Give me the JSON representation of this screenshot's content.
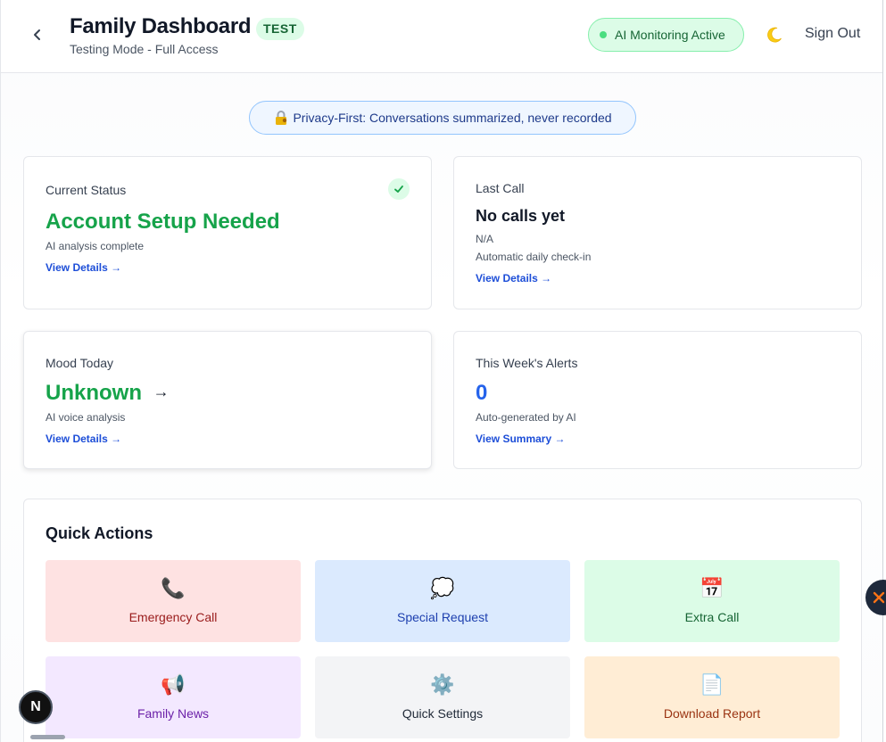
{
  "header": {
    "title": "Family Dashboard",
    "badge": "TEST",
    "subtitle": "Testing Mode - Full Access",
    "ai_status": "AI Monitoring Active",
    "sign_out": "Sign Out",
    "back_icon": "chevron-left-icon",
    "theme_icon": "moon-icon"
  },
  "privacy_banner": {
    "icon": "lock-icon",
    "text": "Privacy-First: Conversations summarized, never recorded"
  },
  "cards": {
    "current_status": {
      "label": "Current Status",
      "value": "Account Setup Needed",
      "note": "AI analysis complete",
      "link": "View Details →"
    },
    "last_call": {
      "label": "Last Call",
      "value": "No calls yet",
      "note1": "N/A",
      "note2": "Automatic daily check-in",
      "link": "View Details →"
    },
    "mood_today": {
      "label": "Mood Today",
      "value": "Unknown",
      "arrow": "→",
      "note": "AI voice analysis",
      "link": "View Details →"
    },
    "alerts": {
      "label": "This Week's Alerts",
      "value": "0",
      "note": "Auto-generated by AI",
      "link": "View Summary →"
    }
  },
  "quick_actions": {
    "title": "Quick Actions",
    "items": [
      {
        "label": "Emergency Call",
        "icon": "phone-icon",
        "glyph": "📞",
        "bg": "#fee2e2",
        "color": "#991b1b"
      },
      {
        "label": "Special Request",
        "icon": "thought-bubble-icon",
        "glyph": "💭",
        "bg": "#dbeafe",
        "color": "#1e40af"
      },
      {
        "label": "Extra Call",
        "icon": "calendar-icon",
        "glyph": "📅",
        "bg": "#dcfce7",
        "color": "#166534"
      },
      {
        "label": "Family News",
        "icon": "megaphone-icon",
        "glyph": "📢",
        "bg": "#f3e8ff",
        "color": "#6b21a8"
      },
      {
        "label": "Quick Settings",
        "icon": "gear-icon",
        "glyph": "⚙️",
        "bg": "#f3f4f6",
        "color": "#1f2937"
      },
      {
        "label": "Download Report",
        "icon": "document-icon",
        "glyph": "📄",
        "bg": "#ffedd5",
        "color": "#9a3412"
      }
    ]
  },
  "floating": {
    "dev_badge": "N"
  },
  "colors": {
    "accent_green": "#16a34a",
    "accent_blue": "#2563eb",
    "link_blue": "#1d4ed8"
  }
}
